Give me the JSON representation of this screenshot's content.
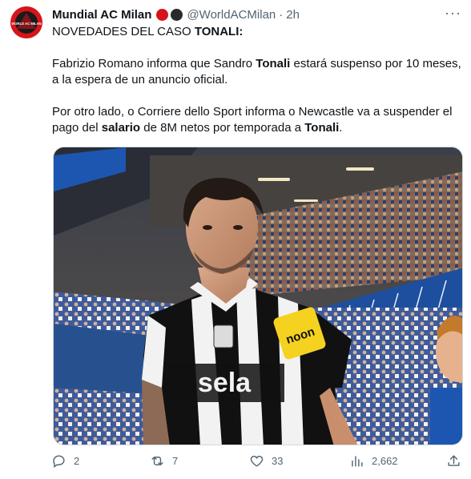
{
  "tweet": {
    "author_name": "Mundial AC Milan",
    "handle": "@WorldACMilan",
    "separator": "·",
    "time": "2h",
    "avatar_text": "WORLD AC MILAN",
    "more": "···",
    "badge_colors": [
      "#d7141a",
      "#2a2a2a"
    ],
    "line1_prefix": "NOVEDADES DEL CASO ",
    "line1_bold": "TONALI:",
    "p2_a": "Fabrizio Romano informa que Sandro ",
    "p2_b": "Tonali",
    "p2_c": " estará suspenso por 10 meses, a la espera de un anuncio oficial.",
    "p3_a": "Por otro lado, o Corriere dello Sport informa o Newcastle va a suspender el pago del ",
    "p3_b": "salario",
    "p3_c": " de 8M netos por temporada a ",
    "p3_d": "Tonali",
    "p3_e": ".",
    "image": {
      "shirt_sponsor": "sela",
      "sleeve_sponsor": "noon",
      "colors": {
        "stand": "#1e4f9e",
        "shirt_black": "#111111",
        "shirt_white": "#f2f2f2",
        "sleeve_badge": "#f5d21f"
      }
    }
  },
  "actions": {
    "replies": "2",
    "retweets": "7",
    "likes": "33",
    "views": "2,662"
  },
  "colors": {
    "text": "#0f1419",
    "secondary": "#536471",
    "border": "#cfd9de"
  }
}
